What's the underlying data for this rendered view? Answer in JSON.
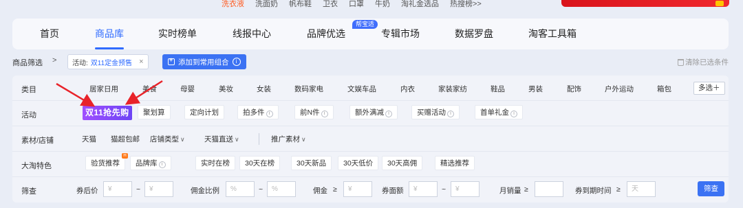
{
  "top_hints": [
    "洗衣液",
    "洗面奶",
    "帆布鞋",
    "卫衣",
    "口罩",
    "牛奶",
    "淘礼金选品",
    "热搜榜>>"
  ],
  "nav": {
    "items": [
      "首页",
      "商品库",
      "实时榜单",
      "线报中心",
      "品牌优选",
      "专辑市场",
      "数据罗盘",
      "淘客工具箱"
    ],
    "active": "商品库",
    "brand_tag": "帮宝适"
  },
  "toolbar": {
    "label": "商品筛选",
    "chevron": ">",
    "chip_prefix": "活动:",
    "chip_value": "双11定金预售",
    "chip_close": "×",
    "add_combo_label": "添加到常用组合",
    "clear_label": "清除已选条件"
  },
  "filters": {
    "category": {
      "label": "类目",
      "items": [
        "居家日用",
        "美食",
        "母婴",
        "美妆",
        "女装",
        "数码家电",
        "文娱车品",
        "内衣",
        "家装家纺",
        "鞋品",
        "男装",
        "配饰",
        "户外运动",
        "箱包"
      ],
      "more": "多选＋"
    },
    "activity": {
      "label": "活动",
      "promo": "双11抢先购",
      "items": [
        "聚划算",
        "定向计划",
        "拍多件",
        "前N件",
        "额外满减",
        "买赠活动",
        "首单礼金"
      ]
    },
    "material": {
      "label": "素材/店铺",
      "items": [
        "天猫",
        "猫超包邮",
        "店铺类型",
        "天猫直送",
        "推广素材"
      ]
    },
    "taotao": {
      "label": "大淘特色",
      "items": [
        "验货推荐",
        "品牌库",
        "实时在榜",
        "30天在榜",
        "30天新品",
        "30天低价",
        "30天高佣",
        "精选推荐"
      ]
    },
    "screen": {
      "label": "筛查",
      "after_coupon": "券后价",
      "commission_rate": "佣金比例",
      "commission": "佣金",
      "coupon_value": "券面额",
      "monthly_sales": "月销量",
      "expire_time": "券到期时间",
      "yen": "¥",
      "percent": "%",
      "day": "天",
      "tilde": "~",
      "gte": "≥",
      "search_btn": "筛查"
    }
  },
  "colors": {
    "accent": "#2f6bff",
    "button": "#3b72f3",
    "promo_start": "#a050ff",
    "promo_end": "#6d43f5",
    "arrow": "#e8232a"
  }
}
